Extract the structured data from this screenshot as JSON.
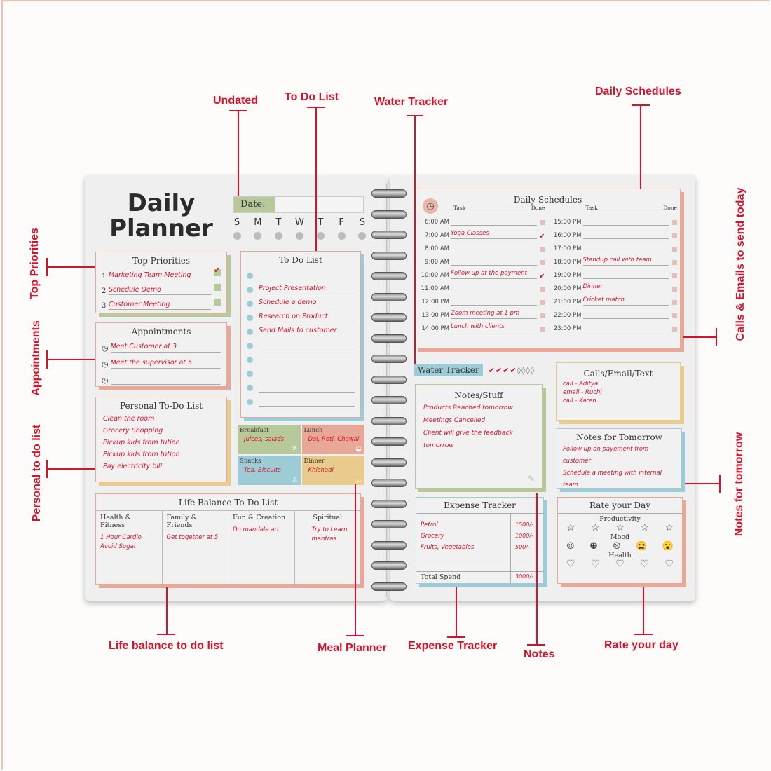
{
  "callouts": {
    "undated": "Undated",
    "to_do_list": "To Do List",
    "water_tracker": "Water Tracker",
    "daily_schedules": "Daily Schedules",
    "top_priorities": "Top Priorities",
    "appointments": "Appointments",
    "personal_to_do": "Personal to do list",
    "calls_emails": "Calls & Emails to send today",
    "notes_for_tomorrow": "Notes for tomorrow",
    "life_balance": "Life balance to do list",
    "meal_planner": "Meal Planner",
    "expense_tracker": "Expense Tracker",
    "notes": "Notes",
    "rate_your_day": "Rate your day"
  },
  "left_page": {
    "title_line1": "Daily",
    "title_line2": "Planner",
    "date_label": "Date:",
    "weekdays": [
      "S",
      "M",
      "T",
      "W",
      "T",
      "F",
      "S"
    ],
    "top_priorities": {
      "title": "Top Priorities",
      "items": [
        {
          "num": "1",
          "text": "Marketing Team Meeting",
          "done": true
        },
        {
          "num": "2",
          "text": "Schedule Demo",
          "done": false
        },
        {
          "num": "3",
          "text": "Customer Meeting",
          "done": false
        }
      ]
    },
    "appointments": {
      "title": "Appointments",
      "items": [
        "Meet Customer at 3",
        "Meet the supervisor at 5",
        ""
      ]
    },
    "personal_todo": {
      "title": "Personal To-Do List",
      "items": [
        "Clean the room",
        "Grocery Shopping",
        "Pickup kids from tution",
        "Pickup kids from tution",
        "Pay electricity bill"
      ]
    },
    "todo": {
      "title": "To Do List",
      "items": [
        "",
        "Project Presentation",
        "Schedule a demo",
        "Research on Product",
        "Send Mails to customer",
        "",
        "",
        "",
        "",
        ""
      ]
    },
    "meals": [
      {
        "label": "Breakfast",
        "text": "Juices, salads",
        "color": "#b7c89a",
        "icon": "fork-knife-icon"
      },
      {
        "label": "Lunch",
        "text": "Dal, Roti, Chawal",
        "color": "#e8a898",
        "icon": "bowl-icon"
      },
      {
        "label": "Snacks",
        "text": "Tea, Biscuits",
        "color": "#9dcbd6",
        "icon": "snack-icon"
      },
      {
        "label": "Dinner",
        "text": "Khichadi",
        "color": "#e8cb8d",
        "icon": "cloche-icon"
      }
    ],
    "life_balance": {
      "title": "Life Balance To-Do List",
      "columns": [
        {
          "header": "Health & Fitness",
          "items": [
            "1 Hour Cardio",
            "Avoid Sugar"
          ]
        },
        {
          "header": "Family & Friends",
          "items": [
            "Get together at 5"
          ]
        },
        {
          "header": "Fun & Creation",
          "items": [
            "Do mandala art"
          ]
        },
        {
          "header": "Spiritual",
          "items": [
            "Try to Learn mantras"
          ]
        }
      ]
    }
  },
  "right_page": {
    "schedules": {
      "title": "Daily Schedules",
      "task_header": "Task",
      "done_header": "Done",
      "left": [
        {
          "time": "6:00 AM",
          "task": "",
          "done": false
        },
        {
          "time": "7:00 AM",
          "task": "Yoga Classes",
          "done": true
        },
        {
          "time": "8:00 AM",
          "task": "",
          "done": false
        },
        {
          "time": "9:00 AM",
          "task": "",
          "done": false
        },
        {
          "time": "10:00 AM",
          "task": "Follow up at the payment",
          "done": true
        },
        {
          "time": "11:00 AM",
          "task": "",
          "done": false
        },
        {
          "time": "12:00 PM",
          "task": "",
          "done": false
        },
        {
          "time": "13:00 PM",
          "task": "Zoom meeting at 1 pm",
          "done": false
        },
        {
          "time": "14:00 PM",
          "task": "Lunch with clients",
          "done": false
        }
      ],
      "right": [
        {
          "time": "15:00 PM",
          "task": "",
          "done": false
        },
        {
          "time": "16:00 PM",
          "task": "",
          "done": false
        },
        {
          "time": "17:00 PM",
          "task": "",
          "done": false
        },
        {
          "time": "18:00 PM",
          "task": "Standup call with team",
          "done": false
        },
        {
          "time": "19:00 PM",
          "task": "",
          "done": false
        },
        {
          "time": "20:00 PM",
          "task": "Dinner",
          "done": false
        },
        {
          "time": "21:00 PM",
          "task": "Cricket match",
          "done": false
        },
        {
          "time": "22:00 PM",
          "task": "",
          "done": false
        },
        {
          "time": "23:00 PM",
          "task": "",
          "done": false
        }
      ]
    },
    "water": {
      "label": "Water Tracker",
      "total": 8,
      "filled": 4
    },
    "calls": {
      "title": "Calls/Email/Text",
      "items": [
        "call - Aditya",
        "email - Ruchi",
        "call - Karen"
      ]
    },
    "notes": {
      "title": "Notes/Stuff",
      "items": [
        "Products Reached tomorrow",
        "Meetings Cancelled",
        "Client will give the feedback tomorrow"
      ]
    },
    "notes_tomorrow": {
      "title": "Notes for Tomorrow",
      "items": [
        "Follow up on payement from customer",
        "Schedule a meeting with internal team"
      ]
    },
    "expense": {
      "title": "Expense Tracker",
      "items": [
        {
          "name": "Petrol",
          "amount": "1500/-"
        },
        {
          "name": "Grocery",
          "amount": "1000/-"
        },
        {
          "name": "Fruits, Vegetables",
          "amount": "500/-"
        }
      ],
      "total_label": "Total Spend",
      "total": "3000/-"
    },
    "rate": {
      "title": "Rate your Day",
      "productivity_label": "Productivity",
      "mood_label": "Mood",
      "health_label": "Health",
      "stars": [
        "☆",
        "☆",
        "☆",
        "☆",
        "☆"
      ],
      "moods": [
        "☺",
        "☻",
        "☹",
        "😫",
        "😮"
      ],
      "hearts": [
        "♡",
        "♡",
        "♡",
        "♡",
        "♡"
      ]
    }
  },
  "colors": {
    "accent": "#d9122a",
    "green": "#b7c89a",
    "salmon": "#e8a898",
    "blue": "#9dcbd6",
    "yellow": "#e8cb8d"
  }
}
